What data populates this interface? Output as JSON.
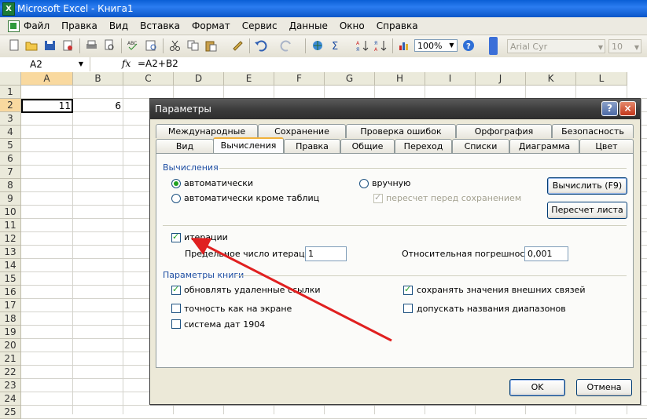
{
  "window": {
    "title": "Microsoft Excel - Книга1"
  },
  "menu": [
    "Файл",
    "Правка",
    "Вид",
    "Вставка",
    "Формат",
    "Сервис",
    "Данные",
    "Окно",
    "Справка"
  ],
  "toolbar": {
    "zoom": "100%",
    "font": "Arial Cyr",
    "size": "10"
  },
  "formula_bar": {
    "name_box": "A2",
    "fx": "fx",
    "formula": "=A2+B2"
  },
  "sheet": {
    "columns": [
      "A",
      "B",
      "C",
      "D",
      "E",
      "F",
      "G",
      "H",
      "I",
      "J",
      "K",
      "L"
    ],
    "rows": [
      "1",
      "2",
      "3",
      "4",
      "5",
      "6",
      "7",
      "8",
      "9",
      "10",
      "11",
      "12",
      "13",
      "14",
      "15",
      "16",
      "17",
      "18",
      "19",
      "20",
      "21",
      "22",
      "23",
      "24",
      "25"
    ],
    "cells": {
      "A2": "11",
      "B2": "6"
    }
  },
  "dialog": {
    "title": "Параметры",
    "help": "?",
    "close": "×",
    "tabs_row1": [
      "Международные",
      "Сохранение",
      "Проверка ошибок",
      "Орфография",
      "Безопасность"
    ],
    "tabs_row2": [
      "Вид",
      "Вычисления",
      "Правка",
      "Общие",
      "Переход",
      "Списки",
      "Диаграмма",
      "Цвет"
    ],
    "active_tab": "Вычисления",
    "calc_group": "Вычисления",
    "opt_auto": "автоматически",
    "opt_auto_except": "автоматически кроме таблиц",
    "opt_manual": "вручную",
    "opt_recalc_save": "пересчет перед сохранением",
    "btn_calc": "Вычислить (F9)",
    "btn_calc_sheet": "Пересчет листа",
    "iterations": "итерации",
    "max_iter_label": "Предельное число итераций:",
    "max_iter_value": "1",
    "rel_error_label": "Относительная погрешность:",
    "rel_error_value": "0,001",
    "book_group": "Параметры книги",
    "update_links": "обновлять удаленные ссылки",
    "save_external": "сохранять значения внешних связей",
    "precision_as_displayed": "точность как на экране",
    "accept_labels": "допускать названия диапазонов",
    "date_1904": "система дат 1904",
    "ok": "OK",
    "cancel": "Отмена"
  },
  "colors": {
    "arrow": "#e02020",
    "title_bar": "#0a5fd6",
    "tab_highlight": "#f1b13a"
  }
}
